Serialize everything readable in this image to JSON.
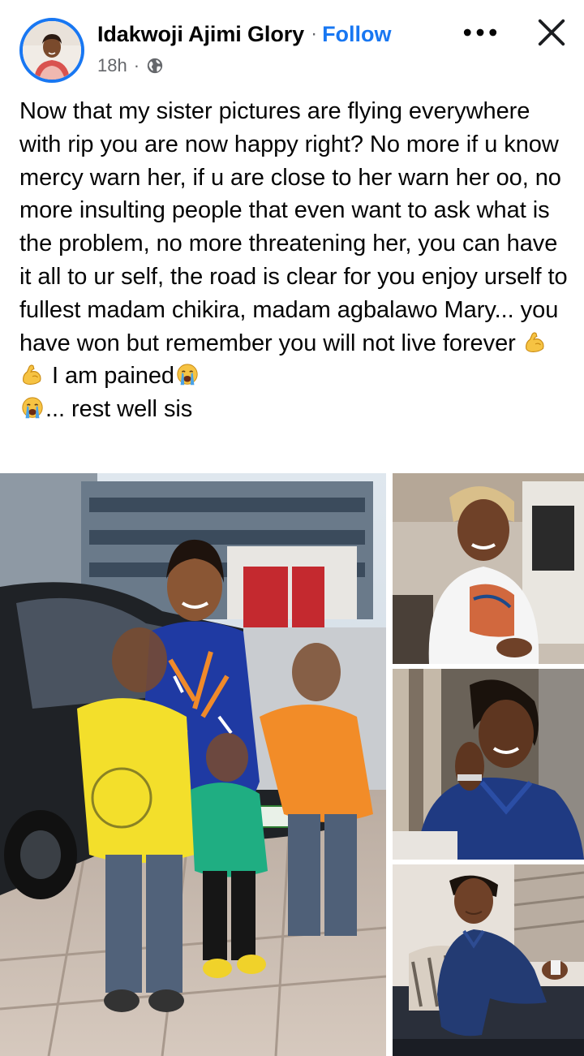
{
  "post": {
    "author": "Idakwoji Ajimi Glory",
    "separator": "·",
    "follow_label": "Follow",
    "time": "18h",
    "time_separator": "·",
    "audience_icon": "globe-icon",
    "more_icon": "more-options-icon",
    "close_icon": "close-icon",
    "body_text": "Now that my sister pictures are flying everywhere with rip you are now happy right? No more if u know mercy warn her, if u are close to her warn her oo, no more insulting people that even want to ask what is the problem, no more threatening her, you can have it all to ur self, the road is clear for you enjoy urself to fullest madam chikira, madam agbalawo Mary... you have won but remember you will not live forever",
    "emoji_flex": "flexed-biceps-emoji",
    "body_text_2": " I am pained",
    "emoji_cry": "loudly-crying-emoji",
    "body_text_3": "... rest well sis"
  },
  "photos": [
    {
      "name": "photo-woman-with-children-by-car"
    },
    {
      "name": "photo-woman-white-shirt-headscarf"
    },
    {
      "name": "photo-woman-blue-shirt-smiling"
    },
    {
      "name": "photo-woman-blue-shirt-seated"
    }
  ],
  "colors": {
    "accent": "#1877f2",
    "text": "#050505",
    "secondary_text": "#65676b"
  }
}
